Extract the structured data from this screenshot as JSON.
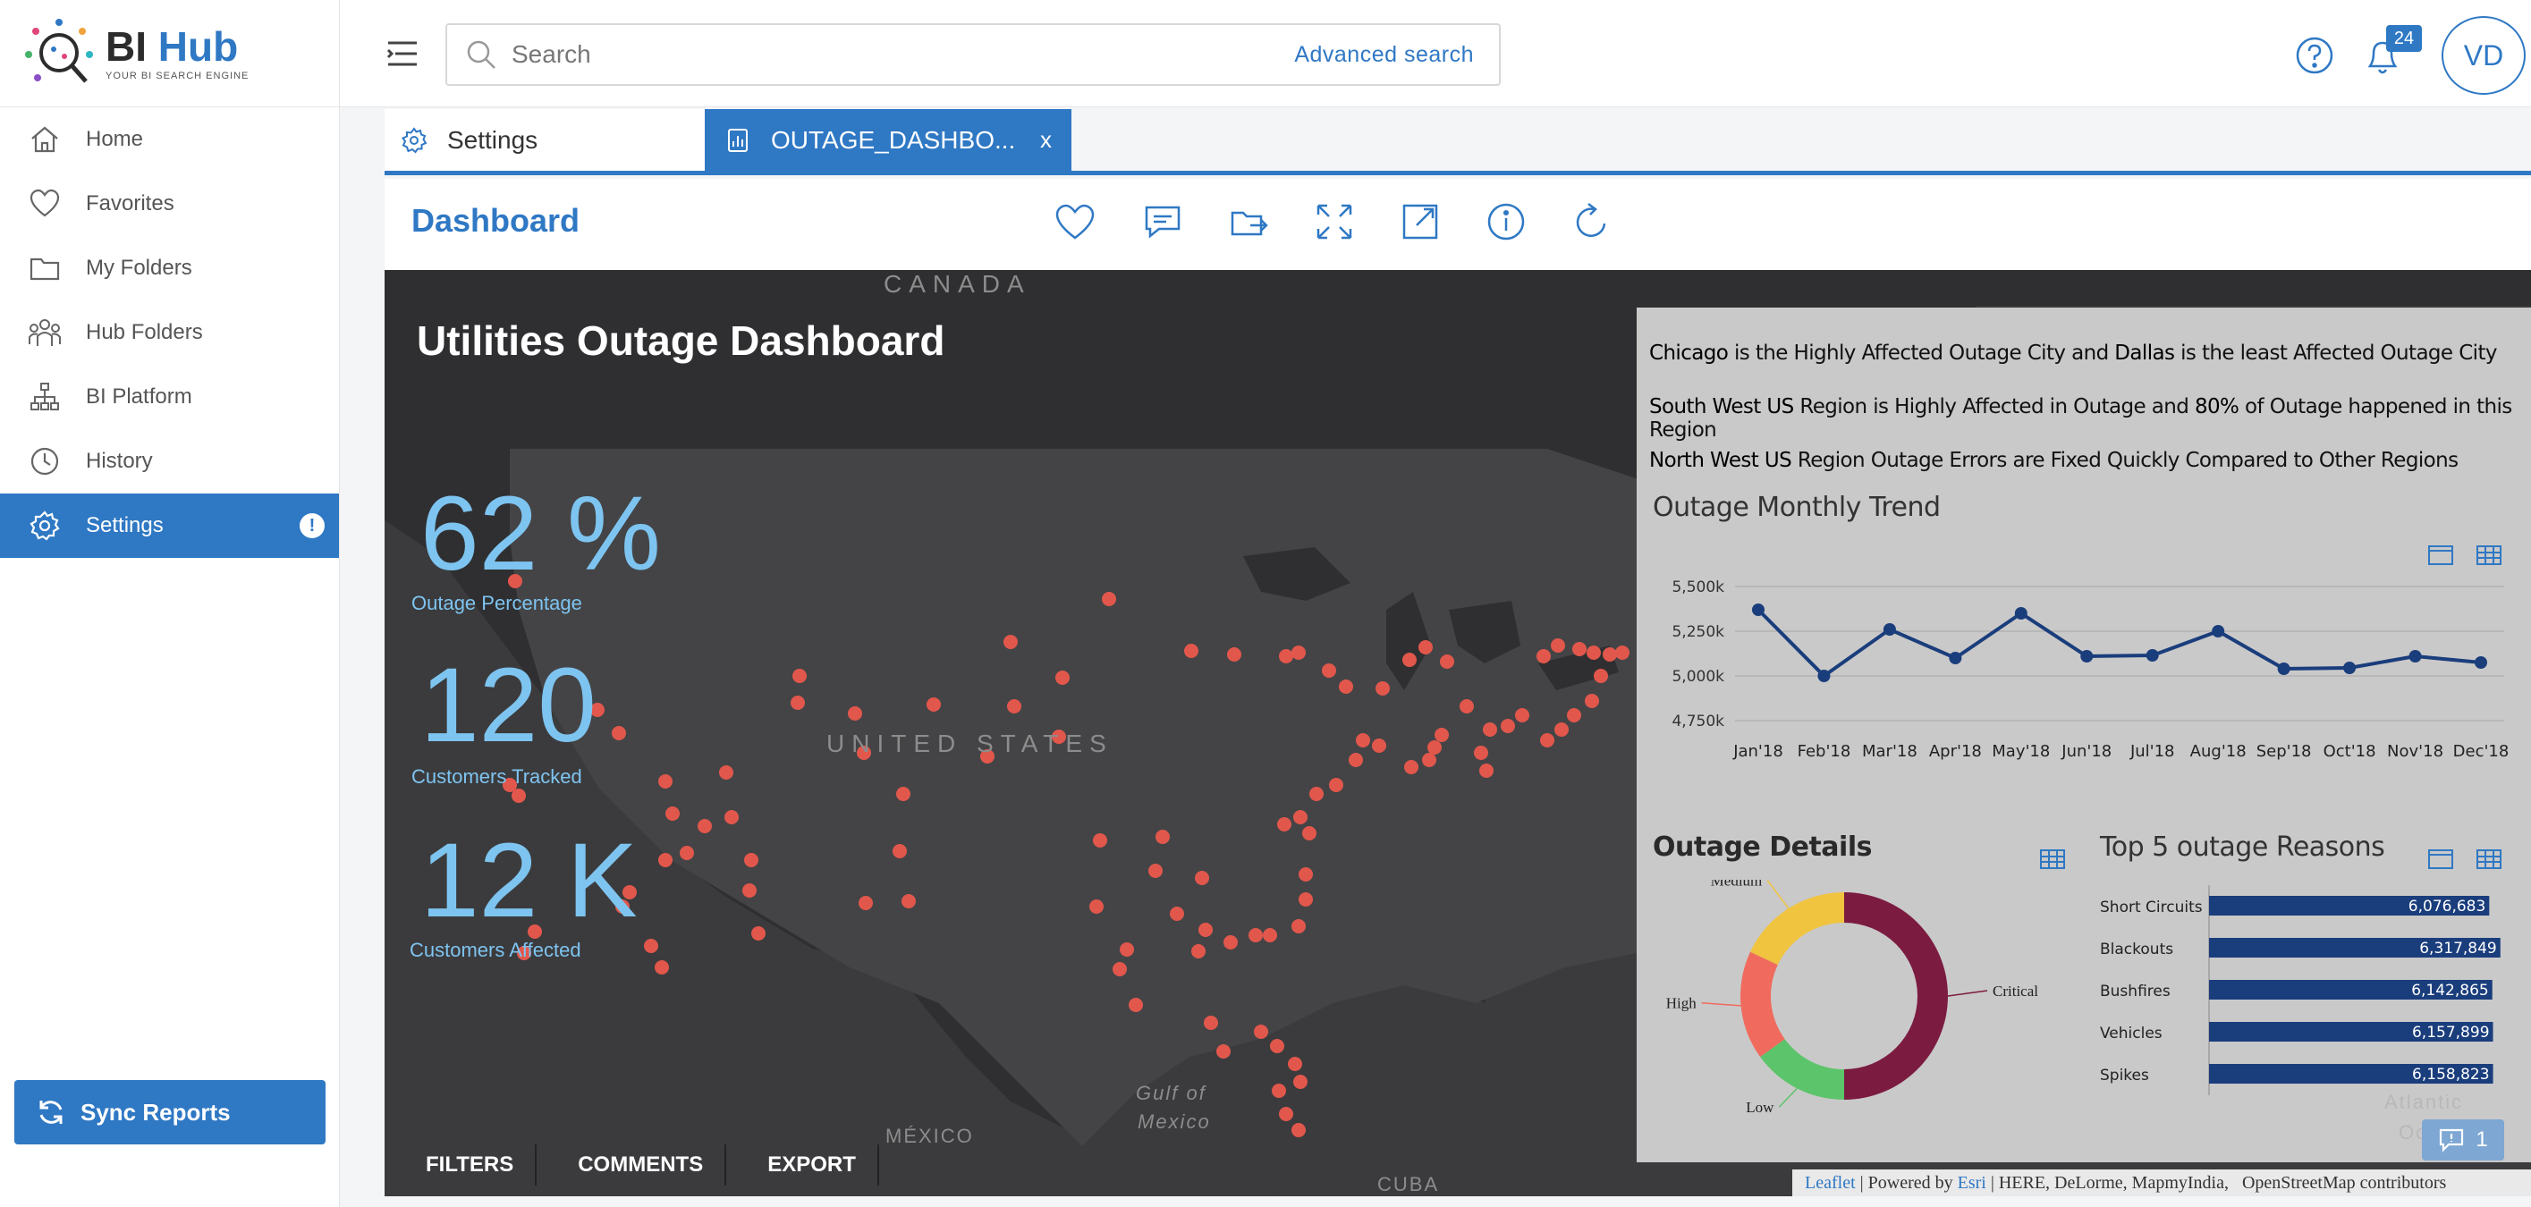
{
  "app": {
    "logo_bi": "BI",
    "logo_hub": "Hub",
    "logo_subtitle": "YOUR BI SEARCH ENGINE"
  },
  "sidebar": {
    "items": [
      {
        "label": "Home",
        "icon": "home-icon"
      },
      {
        "label": "Favorites",
        "icon": "heart-icon"
      },
      {
        "label": "My Folders",
        "icon": "folder-icon"
      },
      {
        "label": "Hub Folders",
        "icon": "users-icon"
      },
      {
        "label": "BI Platform",
        "icon": "hierarchy-icon"
      },
      {
        "label": "History",
        "icon": "clock-icon"
      },
      {
        "label": "Settings",
        "icon": "gear-icon",
        "active": true,
        "alert": "!"
      }
    ],
    "sync_label": "Sync Reports"
  },
  "topbar": {
    "search_placeholder": "Search",
    "advanced_search": "Advanced search",
    "notification_count": "24",
    "user_initials": "VD"
  },
  "tabs": [
    {
      "label": "Settings"
    },
    {
      "label": "OUTAGE_DASHBO...",
      "close": "x",
      "active": true
    }
  ],
  "dashboard": {
    "title": "Dashboard",
    "toolbar": [
      "heart-icon",
      "comment-icon",
      "share-icon",
      "expand-icon",
      "open-external-icon",
      "info-icon",
      "refresh-icon"
    ]
  },
  "report": {
    "title": "Utilities Outage Dashboard",
    "kpis": [
      {
        "value": "62 %",
        "label": "Outage Percentage"
      },
      {
        "value": "120",
        "label": "Customers Tracked"
      },
      {
        "value": "12 K",
        "label": "Customers Affected"
      }
    ],
    "map_labels": {
      "canada": "CANADA",
      "us": "UNITED STATES",
      "mexico": "MÉXICO",
      "gulf1": "Gulf of",
      "gulf2": "Mexico",
      "cuba": "CUBA",
      "atlantic1": "Atlantic",
      "atlantic2": "Ocean"
    },
    "bottom_nav": [
      "FILTERS",
      "COMMENTS",
      "EXPORT"
    ],
    "insights": [
      {
        "parts": [
          "Chicago",
          " is the Highly Affected Outage City and ",
          "Dallas",
          " is the least Affected Outage City"
        ]
      },
      {
        "parts": [
          "South West US",
          " Region is Highly Affected in Outage and ",
          "80%",
          " of Outage happened in this Region"
        ]
      },
      {
        "parts": [
          "North West US",
          " Region Outage Errors are Fixed Quickly Compared to Other Regions"
        ]
      }
    ],
    "attribution": {
      "leaflet": "Leaflet",
      "powered": " | Powered by ",
      "esri": "Esri",
      "rest": " | HERE, DeLorme, MapmyIndia,   OpenStreetMap contributors"
    },
    "comment_count": "1"
  },
  "chart_data": [
    {
      "type": "line",
      "title": "Outage Monthly Trend",
      "categories": [
        "Jan'18",
        "Feb'18",
        "Mar'18",
        "Apr'18",
        "May'18",
        "Jun'18",
        "Jul'18",
        "Aug'18",
        "Sep'18",
        "Oct'18",
        "Nov'18",
        "Dec'18"
      ],
      "values": [
        5370,
        5000,
        5260,
        5100,
        5350,
        5110,
        5115,
        5250,
        5040,
        5045,
        5110,
        5075
      ],
      "ylim": [
        4750,
        5500
      ],
      "yticks": [
        "4,750k",
        "5,000k",
        "5,250k",
        "5,500k"
      ],
      "color": "#1a3d7c"
    },
    {
      "type": "pie",
      "title": "Outage Details",
      "categories": [
        "Critical",
        "Low",
        "High",
        "Medium"
      ],
      "values": [
        50,
        15,
        17,
        18
      ],
      "colors": [
        "#7b1b3f",
        "#5cc46a",
        "#f06b5e",
        "#f0c43f"
      ]
    },
    {
      "type": "bar",
      "title": "Top 5 outage Reasons",
      "categories": [
        "Short Circuits",
        "Blackouts",
        "Bushfires",
        "Vehicles",
        "Spikes"
      ],
      "values": [
        6076683,
        6317849,
        6142865,
        6157899,
        6158823
      ],
      "labels": [
        "6,076,683",
        "6,317,849",
        "6,142,865",
        "6,157,899",
        "6,158,823"
      ],
      "color": "#1a3d7c"
    }
  ]
}
